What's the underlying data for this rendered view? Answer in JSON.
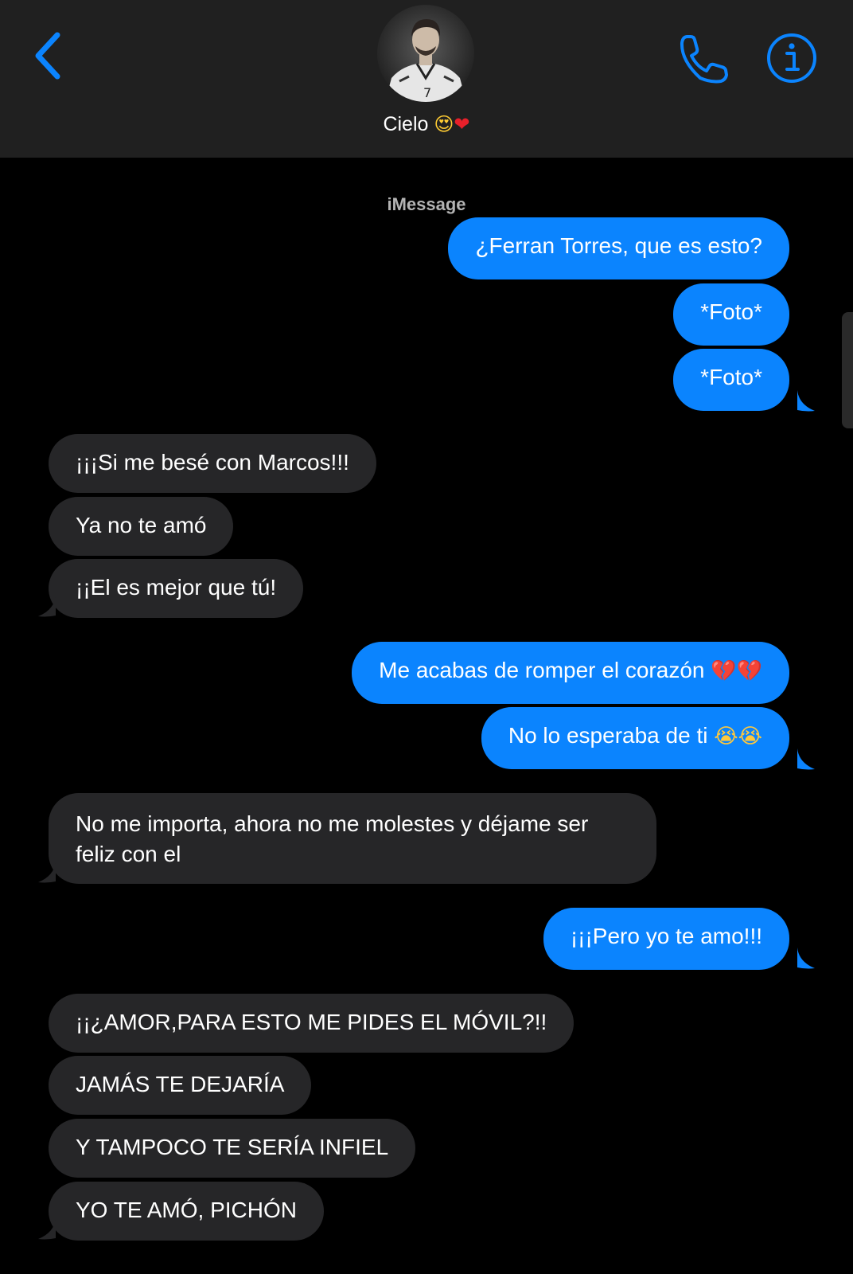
{
  "header": {
    "contact_name": "Cielo",
    "name_emoji_face": "😍",
    "name_emoji_heart": "❤",
    "back_icon": "chevron-left-icon",
    "call_icon": "phone-icon",
    "info_icon": "info-icon"
  },
  "conversation": {
    "service_label": "iMessage",
    "messages": [
      {
        "dir": "out",
        "text": "¿Ferran Torres, que es esto?"
      },
      {
        "dir": "out",
        "text": "*Foto*"
      },
      {
        "dir": "out",
        "text": "*Foto*"
      },
      {
        "dir": "in",
        "text": "¡¡¡Si me besé con Marcos!!!"
      },
      {
        "dir": "in",
        "text": "Ya no te amó"
      },
      {
        "dir": "in",
        "text": "¡¡El es mejor que tú!"
      },
      {
        "dir": "out",
        "text": "Me acabas de romper el corazón",
        "emoji": "💔💔"
      },
      {
        "dir": "out",
        "text": "No lo esperaba de ti",
        "emoji": "😭😭"
      },
      {
        "dir": "in",
        "text": "No me importa, ahora no me molestes y déjame ser feliz con el"
      },
      {
        "dir": "out",
        "text": "¡¡¡Pero yo te amo!!!"
      },
      {
        "dir": "in",
        "text": "¡¡¿AMOR,PARA ESTO ME PIDES EL MÓVIL?!!"
      },
      {
        "dir": "in",
        "text": "JAMÁS TE DEJARÍA"
      },
      {
        "dir": "in",
        "text": "Y TAMPOCO TE SERÍA INFIEL"
      },
      {
        "dir": "in",
        "text": "YO TE AMÓ, PICHÓN"
      }
    ]
  },
  "colors": {
    "accent": "#0b84fe",
    "incoming_bubble": "#262628",
    "header_bg": "#202020",
    "background": "#000000"
  }
}
